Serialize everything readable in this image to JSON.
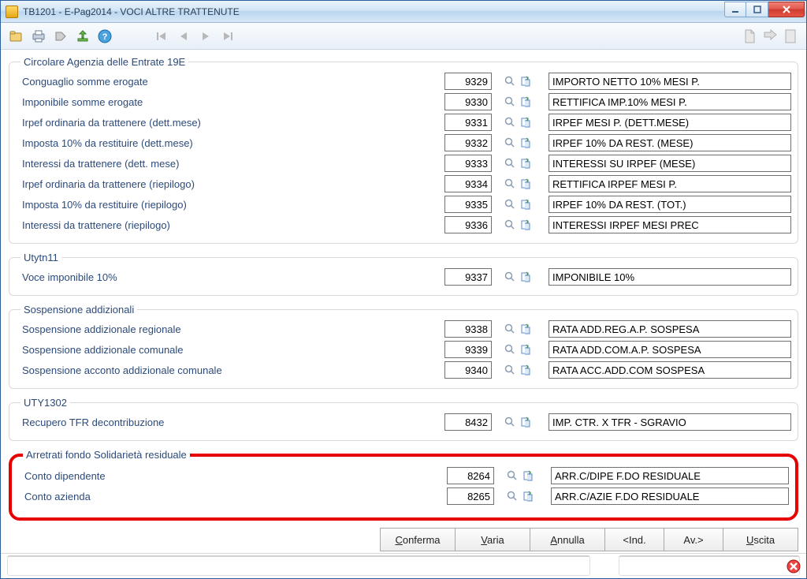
{
  "window": {
    "title": "TB1201  - E-Pag2014  -  VOCI ALTRE TRATTENUTE"
  },
  "groups": [
    {
      "legend": "Circolare Agenzia delle Entrate 19E",
      "rows": [
        {
          "label": "Conguaglio somme erogate",
          "code": "9329",
          "desc": "IMPORTO NETTO 10% MESI P."
        },
        {
          "label": "Imponibile somme erogate",
          "code": "9330",
          "desc": "RETTIFICA IMP.10% MESI P."
        },
        {
          "label": "Irpef ordinaria da trattenere (dett.mese)",
          "code": "9331",
          "desc": "IRPEF MESI P. (DETT.MESE)"
        },
        {
          "label": "Imposta 10% da restituire (dett.mese)",
          "code": "9332",
          "desc": "IRPEF 10% DA REST. (MESE)"
        },
        {
          "label": "Interessi da trattenere (dett. mese)",
          "code": "9333",
          "desc": "INTERESSI SU IRPEF (MESE)"
        },
        {
          "label": "Irpef ordinaria da trattenere (riepilogo)",
          "code": "9334",
          "desc": "RETTIFICA IRPEF MESI P."
        },
        {
          "label": "Imposta 10% da restituire (riepilogo)",
          "code": "9335",
          "desc": "IRPEF 10% DA REST. (TOT.)"
        },
        {
          "label": "Interessi da trattenere (riepilogo)",
          "code": "9336",
          "desc": "INTERESSI IRPEF MESI PREC"
        }
      ]
    },
    {
      "legend": "Utytn11",
      "rows": [
        {
          "label": "Voce imponibile 10%",
          "code": "9337",
          "desc": "IMPONIBILE 10%"
        }
      ]
    },
    {
      "legend": "Sospensione addizionali",
      "rows": [
        {
          "label": "Sospensione addizionale regionale",
          "code": "9338",
          "desc": "RATA ADD.REG.A.P. SOSPESA"
        },
        {
          "label": "Sospensione addizionale comunale",
          "code": "9339",
          "desc": "RATA ADD.COM.A.P. SOSPESA"
        },
        {
          "label": "Sospensione acconto addizionale comunale",
          "code": "9340",
          "desc": "RATA ACC.ADD.COM SOSPESA"
        }
      ]
    },
    {
      "legend": "UTY1302",
      "rows": [
        {
          "label": "Recupero TFR decontribuzione",
          "code": "8432",
          "desc": "IMP. CTR. X TFR - SGRAVIO"
        }
      ]
    },
    {
      "legend": "Arretrati fondo Solidarietà residuale",
      "highlight": true,
      "rows": [
        {
          "label": "Conto dipendente",
          "code": "8264",
          "desc": "ARR.C/DIPE F.DO RESIDUALE"
        },
        {
          "label": "Conto azienda",
          "code": "8265",
          "desc": "ARR.C/AZIE F.DO RESIDUALE"
        }
      ]
    }
  ],
  "buttons": {
    "confirm": "Conferma",
    "vary": "Varia",
    "cancel": "Annulla",
    "back": "<Ind.",
    "next": "Av.>",
    "exit": "Uscita"
  }
}
